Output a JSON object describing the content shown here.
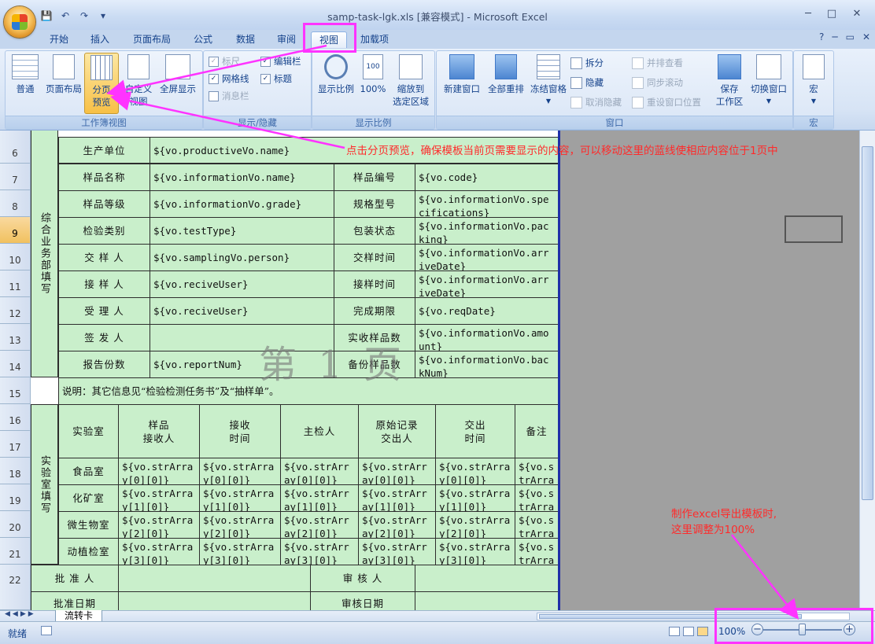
{
  "window": {
    "title": "samp-task-lgk.xls  [兼容模式] - Microsoft Excel",
    "minimize": "─",
    "maximize": "□",
    "close": "✕"
  },
  "qat": {
    "save": "💾",
    "undo": "↶",
    "redo": "↷",
    "more": "▾"
  },
  "tabs": [
    "开始",
    "插入",
    "页面布局",
    "公式",
    "数据",
    "审阅",
    "视图",
    "加载项"
  ],
  "active_tab": "视图",
  "help": {
    "help": "?",
    "min": "─",
    "restore": "▭",
    "close": "✕"
  },
  "ribbon": {
    "workbook_views": {
      "label": "工作簿视图",
      "normal": "普通",
      "page_layout": "页面布局",
      "page_break_l1": "分页",
      "page_break_l2": "预览",
      "custom_l1": "自定义",
      "custom_l2": "视图",
      "fullscreen": "全屏显示"
    },
    "show_hide": {
      "label": "显示/隐藏",
      "ruler": "标尺",
      "gridlines": "网格线",
      "message_bar": "消息栏",
      "formula_bar": "编辑栏",
      "headings": "标题"
    },
    "zoom": {
      "label": "显示比例",
      "zoom": "显示比例",
      "hundred": "100%",
      "zoom_sel_l1": "缩放到",
      "zoom_sel_l2": "选定区域"
    },
    "window": {
      "label": "窗口",
      "new_window": "新建窗口",
      "arrange_all": "全部重排",
      "freeze": "冻结窗格",
      "split": "拆分",
      "hide": "隐藏",
      "unhide": "取消隐藏",
      "side_by_side": "并排查看",
      "sync_scroll": "同步滚动",
      "reset_pos": "重设窗口位置",
      "save_ws_l1": "保存",
      "save_ws_l2": "工作区",
      "switch": "切换窗口"
    },
    "macros": {
      "label": "宏",
      "macro": "宏"
    }
  },
  "rows": [
    "6",
    "7",
    "8",
    "9",
    "10",
    "11",
    "12",
    "13",
    "14",
    "15",
    "16",
    "17",
    "18",
    "19",
    "20",
    "21",
    "22"
  ],
  "selected_row": "9",
  "sheet": {
    "side_1": "综合业务部填写",
    "side_2": "实验室填写",
    "r6": {
      "a": "生产单位",
      "b": "${vo.productiveVo.name}"
    },
    "r7": {
      "a": "样品名称",
      "b": "${vo.informationVo.name}",
      "c": "样品编号",
      "d": "${vo.code}"
    },
    "r8": {
      "a": "样品等级",
      "b": "${vo.informationVo.grade}",
      "c": "规格型号",
      "d": "${vo.informationVo.specifications}"
    },
    "r9": {
      "a": "检验类别",
      "b": "${vo.testType}",
      "c": "包装状态",
      "d": "${vo.informationVo.packing}"
    },
    "r10": {
      "a": "交 样 人",
      "b": "${vo.samplingVo.person}",
      "c": "交样时间",
      "d": "${vo.informationVo.arriveDate}"
    },
    "r11": {
      "a": "接 样 人",
      "b": "${vo.reciveUser}",
      "c": "接样时间",
      "d": "${vo.informationVo.arriveDate}"
    },
    "r12": {
      "a": "受 理 人",
      "b": "${vo.reciveUser}",
      "c": "完成期限",
      "d": "${vo.reqDate}"
    },
    "r13": {
      "a": "签 发 人",
      "b": "",
      "c": "实收样品数",
      "d": "${vo.informationVo.amount}"
    },
    "r14": {
      "a": "报告份数",
      "b": "${vo.reportNum}",
      "c": "备份样品数",
      "d": "${vo.informationVo.backNum}"
    },
    "r15": "说明：其它信息见“检验检测任务书”及“抽样单”。",
    "lab_headers": [
      "实验室",
      "样品\n接收人",
      "接收\n时间",
      "主检人",
      "原始记录\n交出人",
      "交出\n时间",
      "备注"
    ],
    "lab_rows": [
      {
        "name": "食品室",
        "v": "${vo.strArray[0][0]}"
      },
      {
        "name": "化矿室",
        "v": "${vo.strArray[1][0]}"
      },
      {
        "name": "微生物室",
        "v": "${vo.strArray[2][0]}"
      },
      {
        "name": "动植检室",
        "v": "${vo.strArray[3][0]}"
      }
    ],
    "r22": {
      "a": "批 准 人",
      "c": "审 核 人"
    },
    "r23": {
      "a": "批准日期",
      "c": "审核日期"
    },
    "watermark": "第 1 页"
  },
  "annotations": {
    "top": "点击分页预览，确保模板当前页需要显示的内容，可以移动这里的蓝线使相应内容位于1页中",
    "bottom_l1": "制作excel导出模板时,",
    "bottom_l2": "这里调整为100%"
  },
  "sheet_tab": "流转卡",
  "status": {
    "ready": "就绪",
    "zoom": "100%",
    "minus": "−",
    "plus": "+"
  },
  "colors": {
    "annotation": "#ff2a2a",
    "highlight": "#ff33ff",
    "cell_fill": "#c9efcb",
    "page_break_line": "#1f2fa8"
  }
}
